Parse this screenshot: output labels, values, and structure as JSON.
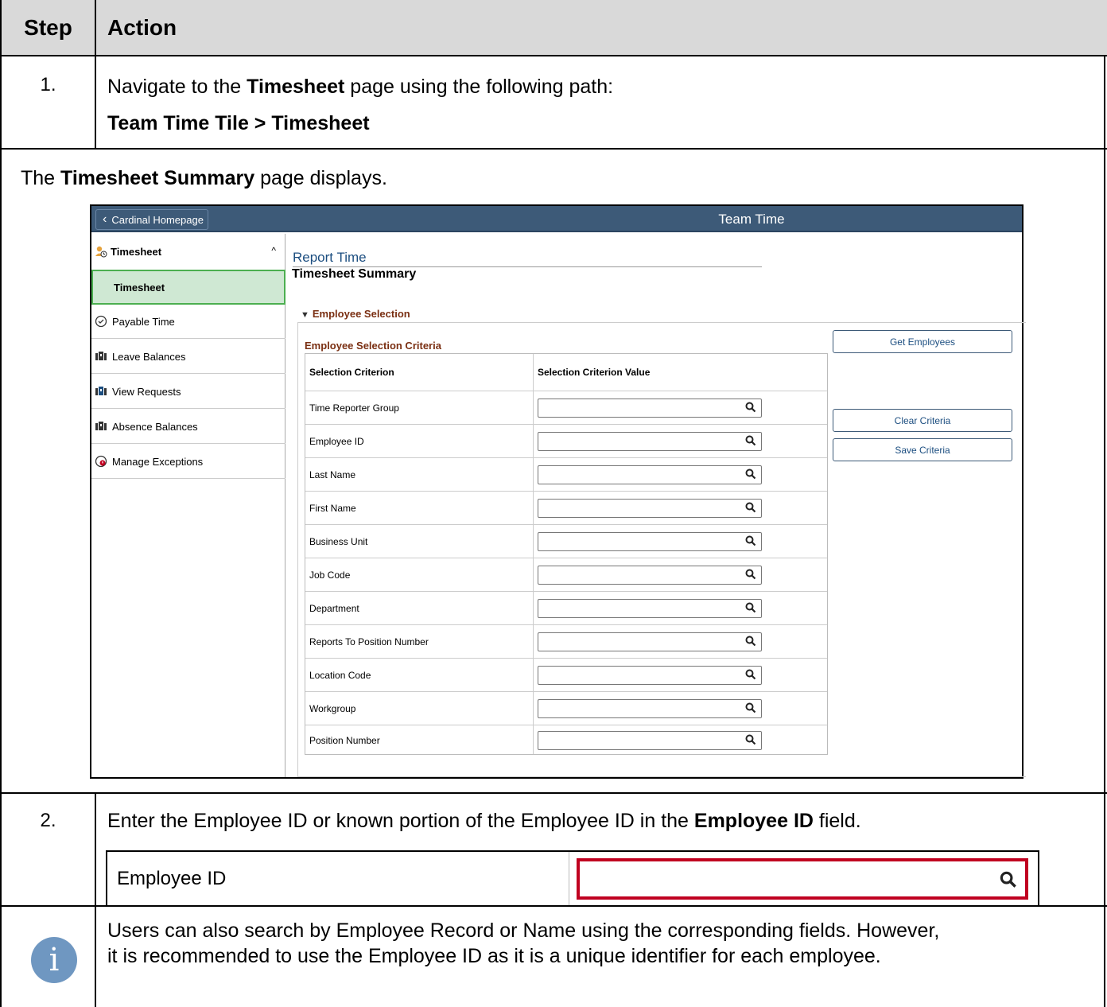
{
  "table_header": {
    "step": "Step",
    "action": "Action"
  },
  "step1": {
    "number": "1.",
    "line1_pre": "Navigate to the ",
    "line1_bold": "Timesheet",
    "line1_post": " page using the following path:",
    "path": "Team Time Tile > Timesheet"
  },
  "summary_note": {
    "pre": "The ",
    "bold": "Timesheet Summary",
    "post": " page displays."
  },
  "app": {
    "home_button": "Cardinal Homepage",
    "title": "Team Time",
    "sidebar": {
      "group": "Timesheet",
      "active_item": "Timesheet",
      "items": [
        {
          "label": "Payable Time",
          "icon": "clock-icon"
        },
        {
          "label": "Leave Balances",
          "icon": "balances-icon"
        },
        {
          "label": "View Requests",
          "icon": "requests-icon"
        },
        {
          "label": "Absence Balances",
          "icon": "balances-icon"
        },
        {
          "label": "Manage Exceptions",
          "icon": "exception-icon"
        }
      ]
    },
    "report_time": "Report Time",
    "page_title": "Timesheet Summary",
    "section": "Employee Selection",
    "criteria_title": "Employee Selection Criteria",
    "columns": [
      "Selection Criterion",
      "Selection Criterion Value"
    ],
    "criteria": [
      "Time Reporter Group",
      "Employee ID",
      "Last Name",
      "First Name",
      "Business Unit",
      "Job Code",
      "Department",
      "Reports To Position Number",
      "Location Code",
      "Workgroup",
      "Position Number"
    ],
    "buttons": {
      "get": "Get Employees",
      "clear": "Clear Criteria",
      "save": "Save Criteria"
    }
  },
  "step2": {
    "number": "2.",
    "pre": "Enter the Employee ID or known portion of the Employee ID in the ",
    "bold": "Employee ID",
    "post": " field.",
    "zoom_label": "Employee ID"
  },
  "info": {
    "line1": "Users can also search by Employee Record or Name using the corresponding fields.  However,",
    "line2": "it is recommended to use the Employee ID as it is a unique identifier for each employee."
  }
}
